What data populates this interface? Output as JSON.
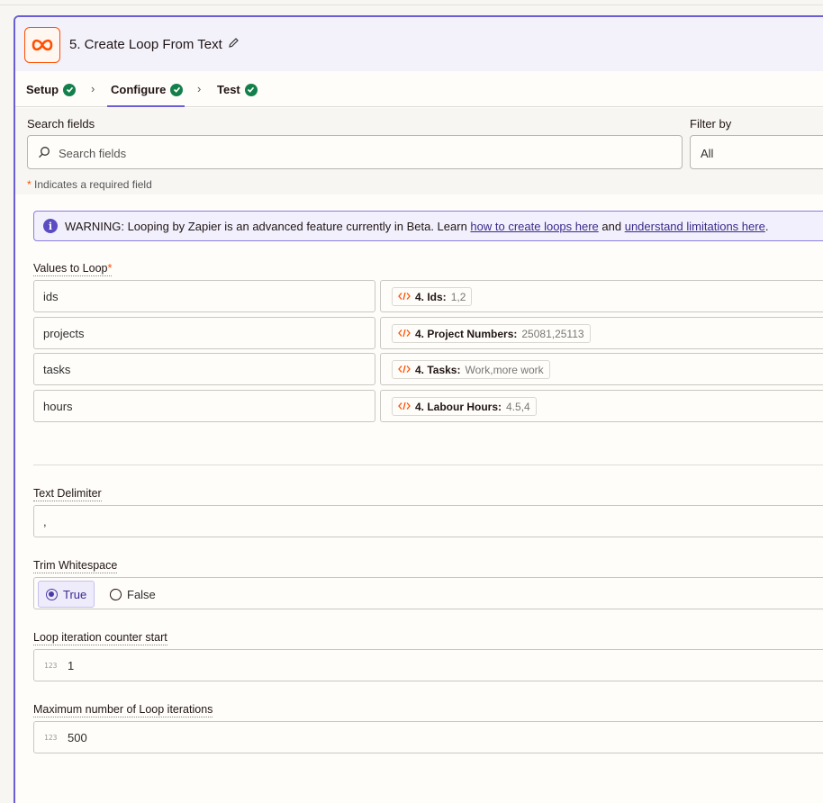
{
  "step": {
    "title": "5. Create Loop From Text"
  },
  "tabs": [
    {
      "label": "Setup"
    },
    {
      "label": "Configure"
    },
    {
      "label": "Test"
    }
  ],
  "search": {
    "label": "Search fields",
    "placeholder": "Search fields"
  },
  "filter": {
    "label": "Filter by",
    "value": "All"
  },
  "required_note": {
    "star": "*",
    "text": "Indicates a required field"
  },
  "warning": {
    "text": "WARNING: Looping by Zapier is an advanced feature currently in Beta. Learn ",
    "link1": "how to create loops here",
    "mid": " and ",
    "link2": "understand limitations here",
    "end": "."
  },
  "values_to_loop": {
    "label": "Values to Loop",
    "star": "*",
    "rows": [
      {
        "key": "ids",
        "pill_key": "4. Ids:",
        "pill_val": "1,2"
      },
      {
        "key": "projects",
        "pill_key": "4. Project Numbers:",
        "pill_val": "25081,25113"
      },
      {
        "key": "tasks",
        "pill_key": "4. Tasks:",
        "pill_val": "Work,more work"
      },
      {
        "key": "hours",
        "pill_key": "4. Labour Hours:",
        "pill_val": "4.5,4"
      }
    ]
  },
  "text_delimiter": {
    "label": "Text Delimiter",
    "value": ","
  },
  "trim_whitespace": {
    "label": "Trim Whitespace",
    "options": [
      "True",
      "False"
    ],
    "selected": "True"
  },
  "counter_start": {
    "label": "Loop iteration counter start",
    "icon_text": "123",
    "value": "1"
  },
  "max_iterations": {
    "label": "Maximum number of Loop iterations",
    "icon_text": "123",
    "value": "500"
  },
  "colors": {
    "accent": "#6b5dd3",
    "brand": "#ff4f00",
    "success": "#13804b"
  }
}
